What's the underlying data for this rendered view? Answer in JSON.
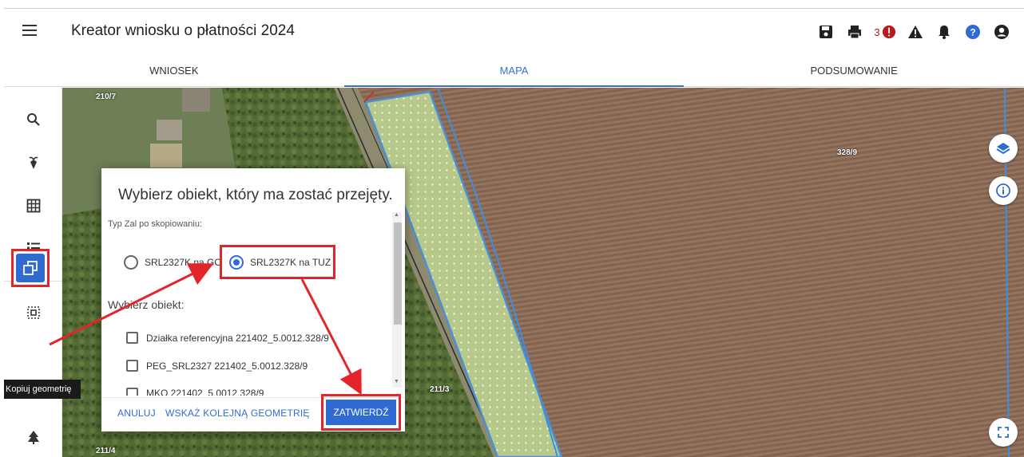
{
  "header": {
    "title": "Kreator wniosku o płatności 2024",
    "error_count": "3",
    "icons": [
      "save-icon",
      "print-icon",
      "error-icon",
      "warning-icon",
      "bell-icon",
      "help-icon",
      "account-icon"
    ]
  },
  "tabs": [
    {
      "label": "WNIOSEK",
      "active": false
    },
    {
      "label": "MAPA",
      "active": true
    },
    {
      "label": "PODSUMOWANIE",
      "active": false
    }
  ],
  "sidebar": {
    "tools": [
      "search-icon",
      "plant-icon",
      "grid-icon",
      "list-icon",
      "select-area-icon",
      "copy-geometry-icon",
      "tree-icon"
    ],
    "tooltip": "Kopiuj geometrię"
  },
  "map": {
    "parcel_labels": [
      "210/7",
      "328/9",
      "211/3",
      "211/4"
    ]
  },
  "dialog": {
    "title": "Wybierz obiekt, który ma zostać przejęty.",
    "type_label": "Typ Zal po skopiowaniu:",
    "radio_options": [
      {
        "label": "SRL2327K na GO",
        "selected": false
      },
      {
        "label": "SRL2327K na TUZ",
        "selected": true
      }
    ],
    "object_label": "Wybierz obiekt:",
    "objects": [
      {
        "label": "Działka referencyjna 221402_5.0012.328/9",
        "checked": false
      },
      {
        "label": "PEG_SRL2327 221402_5.0012.328/9",
        "checked": false
      },
      {
        "label": "MKO 221402_5.0012.328/9",
        "checked": false
      }
    ],
    "actions": {
      "cancel": "ANULUJ",
      "next": "WSKAŻ KOLEJNĄ GEOMETRIĘ",
      "confirm": "ZATWIERDŹ"
    }
  },
  "colors": {
    "accent": "#2f6bd3",
    "annotation": "#e3242b",
    "error": "#c1121f"
  }
}
